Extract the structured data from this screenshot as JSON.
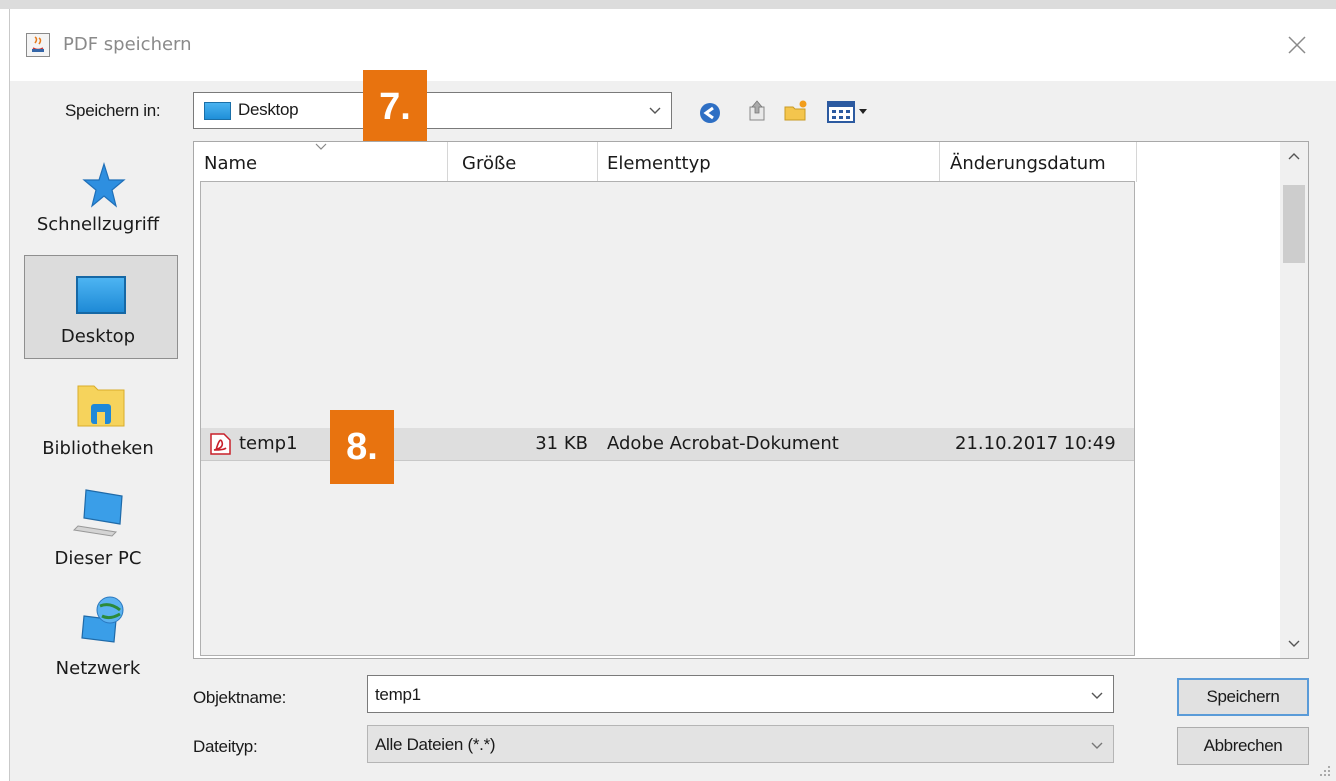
{
  "window": {
    "title": "PDF speichern"
  },
  "save_in": {
    "label": "Speichern in:",
    "value": "Desktop"
  },
  "annotations": {
    "step7": "7.",
    "step8": "8."
  },
  "places": [
    {
      "label": "Schnellzugriff",
      "icon": "star-icon"
    },
    {
      "label": "Desktop",
      "icon": "desktop-icon"
    },
    {
      "label": "Bibliotheken",
      "icon": "library-icon"
    },
    {
      "label": "Dieser PC",
      "icon": "computer-icon"
    },
    {
      "label": "Netzwerk",
      "icon": "network-icon"
    }
  ],
  "table": {
    "columns": [
      "Name",
      "Größe",
      "Elementtyp",
      "Änderungsdatum"
    ],
    "rows": [
      {
        "name": "temp1",
        "size": "31 KB",
        "type": "Adobe Acrobat-Dokument",
        "date": "21.10.2017 10:49",
        "icon": "pdf-icon"
      }
    ]
  },
  "filename": {
    "label": "Objektname:",
    "value": "temp1"
  },
  "filetype": {
    "label": "Dateityp:",
    "value": "Alle Dateien (*.*)"
  },
  "buttons": {
    "save": "Speichern",
    "cancel": "Abbrechen"
  },
  "colors": {
    "badge": "#e8730f",
    "selection": "#dcdcdc",
    "accent": "#1f8fd8"
  }
}
